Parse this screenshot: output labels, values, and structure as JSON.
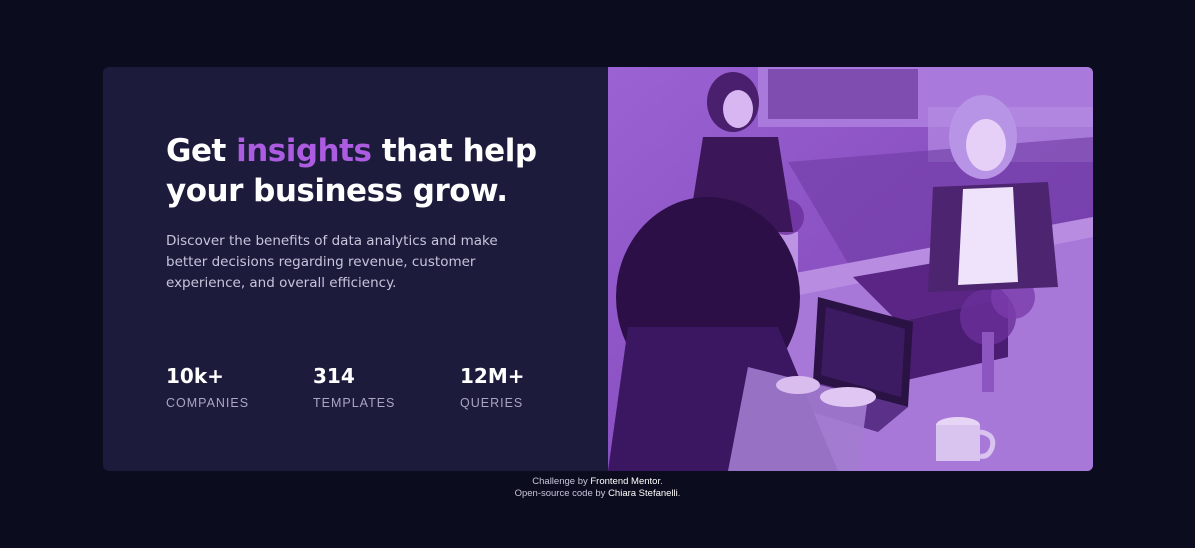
{
  "card": {
    "headline": {
      "before": "Get ",
      "accent": "insights",
      "after": " that help your business grow."
    },
    "description": "Discover the benefits of data analytics and make better decisions regarding revenue, customer experience, and overall efficiency.",
    "stats": [
      {
        "value": "10k+",
        "label": "COMPANIES"
      },
      {
        "value": "314",
        "label": "TEMPLATES"
      },
      {
        "value": "12M+",
        "label": "QUERIES"
      }
    ]
  },
  "footer": {
    "line1_prefix": "Challenge by ",
    "line1_link": "Frontend Mentor",
    "line1_suffix": ".",
    "line2_prefix": "Open-source code by ",
    "line2_link": "Chiara Stefanelli",
    "line2_suffix": "."
  },
  "colors": {
    "background": "#0b0c1e",
    "card": "#1c1b3b",
    "accent": "#ab5ce0",
    "image_tint": "#8a4fc4"
  },
  "image": {
    "subject": "photo-people-working-at-table"
  }
}
